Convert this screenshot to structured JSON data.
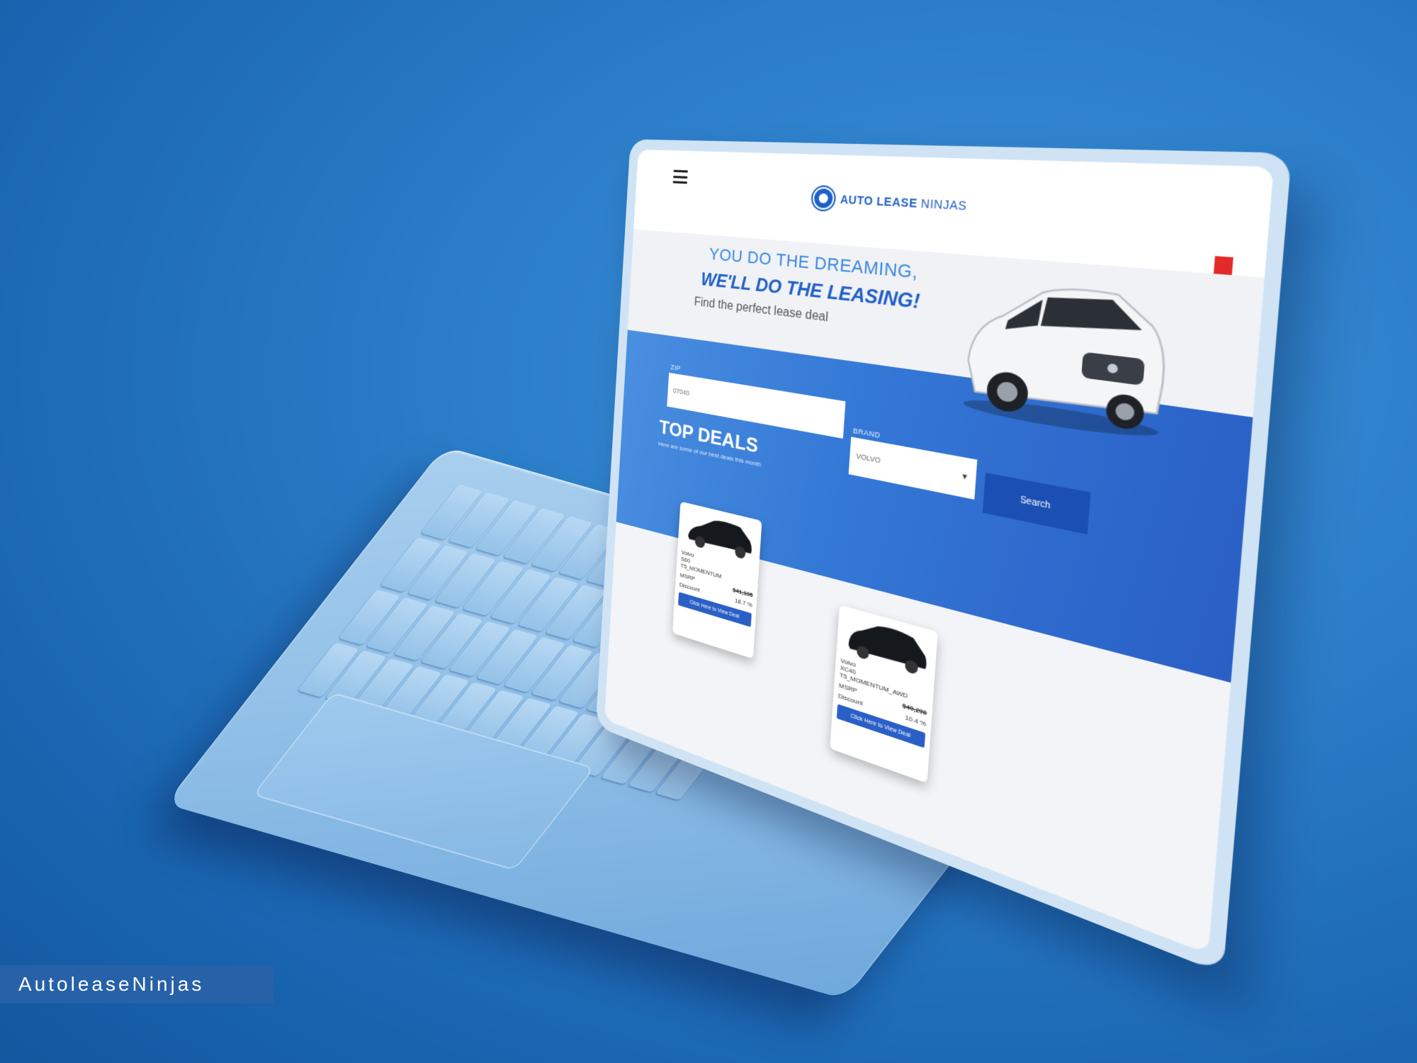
{
  "site": {
    "brand_bold": "AUTO LEASE",
    "brand_light": " NINJAS",
    "hero": {
      "line1": "YOU DO THE DREAMING,",
      "line2": "WE'LL DO THE LEASING!",
      "line3": "Find the perfect lease deal"
    },
    "search": {
      "zip_label": "ZIP",
      "zip_placeholder": "07040",
      "brand_label": "BRAND",
      "brand_value": "VOLVO",
      "search_label": "Search"
    },
    "top_deals": {
      "title": "TOP DEALS",
      "subtitle": "Here are some of our best deals this month"
    },
    "deals": [
      {
        "make": "Volvo",
        "model": "S60",
        "trim": "T5_MOMENTUM",
        "msrp_label": "MSRP",
        "msrp_value": "$41,195",
        "discount_label": "Discount",
        "discount_value": "18.7 %",
        "cta": "Click Here to View Deal"
      },
      {
        "make": "Volvo",
        "model": "XC40",
        "trim": "T5_MOMENTUM_AWD",
        "msrp_label": "MSRP",
        "msrp_value": "$40,290",
        "discount_label": "Discount",
        "discount_value": "10.4 %",
        "cta": "Click Here to View Deal"
      }
    ]
  },
  "watermark": "AutoleaseNinjas",
  "colors": {
    "brand_blue": "#1f5fc8",
    "band_blue": "#3478d6",
    "bookmark_red": "#e32929",
    "background": "#2a7cc8"
  }
}
